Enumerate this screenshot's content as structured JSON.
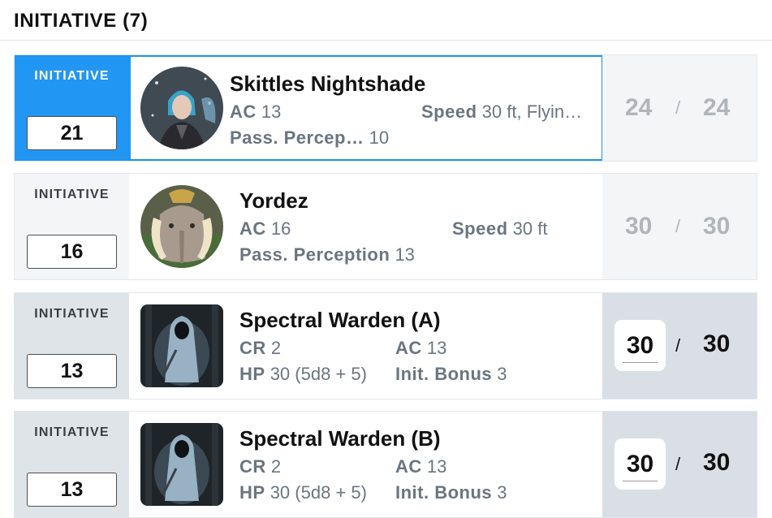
{
  "header": {
    "title": "INITIATIVE (7)"
  },
  "init_label": "INITIATIVE",
  "rows": [
    {
      "init": "21",
      "name": "Skittles Nightshade",
      "stats": {
        "ac_label": "AC",
        "ac": "13",
        "speed_label": "Speed",
        "speed": "30 ft, Flyin…",
        "pp_label": "Pass. Percep…",
        "pp": "10"
      },
      "hp_current": "24",
      "hp_sep": "/",
      "hp_max": "24"
    },
    {
      "init": "16",
      "name": "Yordez",
      "stats": {
        "ac_label": "AC",
        "ac": "16",
        "speed_label": "Speed",
        "speed": "30 ft",
        "pp_label": "Pass. Perception",
        "pp": "13"
      },
      "hp_current": "30",
      "hp_sep": "/",
      "hp_max": "30"
    },
    {
      "init": "13",
      "name": "Spectral Warden (A)",
      "stats": {
        "cr_label": "CR",
        "cr": "2",
        "ac_label": "AC",
        "ac": "13",
        "hp_label": "HP",
        "hp": "30 (5d8 + 5)",
        "ib_label": "Init. Bonus",
        "ib": "3"
      },
      "hp_current": "30",
      "hp_sep": "/",
      "hp_max": "30"
    },
    {
      "init": "13",
      "name": "Spectral Warden (B)",
      "stats": {
        "cr_label": "CR",
        "cr": "2",
        "ac_label": "AC",
        "ac": "13",
        "hp_label": "HP",
        "hp": "30 (5d8 + 5)",
        "ib_label": "Init. Bonus",
        "ib": "3"
      },
      "hp_current": "30",
      "hp_sep": "/",
      "hp_max": "30"
    }
  ],
  "colors": {
    "active_accent": "#2196f3",
    "muted_text": "#6b7580",
    "npc_bg": "#d9dfe5"
  }
}
